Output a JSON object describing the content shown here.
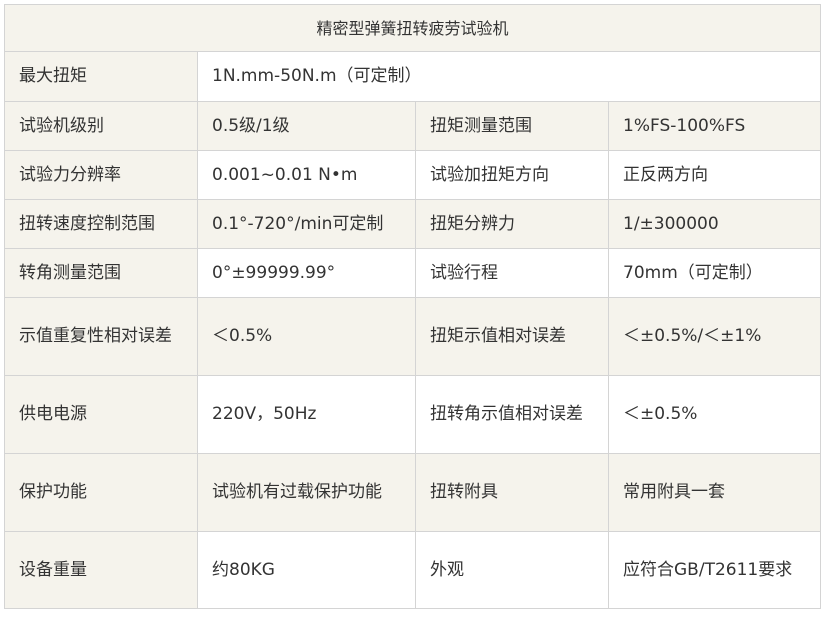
{
  "table": {
    "title": "精密型弹簧扭转疲劳试验机",
    "rows": [
      {
        "l1": "最大扭矩",
        "v1": "1N.mm-50N.m（可定制）"
      },
      {
        "l1": "试验机级别",
        "v1": "0.5级/1级",
        "l2": "扭矩测量范围",
        "v2": "1%FS-100%FS"
      },
      {
        "l1": "试验力分辨率",
        "v1": "0.001~0.01 N•m",
        "l2": "试验加扭矩方向",
        "v2": "正反两方向"
      },
      {
        "l1": "扭转速度控制范围",
        "v1": "0.1°-720°/min可定制",
        "l2": "扭矩分辨力",
        "v2": "1/±300000"
      },
      {
        "l1": "转角测量范围",
        "v1": "0°±99999.99°",
        "l2": "试验行程",
        "v2": "70mm（可定制）"
      },
      {
        "l1": "示值重复性相对误差",
        "v1": "＜0.5%",
        "l2": "扭矩示值相对误差",
        "v2": "＜±0.5%/＜±1%"
      },
      {
        "l1": "供电电源",
        "v1": "220V，50Hz",
        "l2": "扭转角示值相对误差",
        "v2": "＜±0.5%"
      },
      {
        "l1": "保护功能",
        "v1": "试验机有过载保护功能",
        "l2": "扭转附具",
        "v2": "常用附具一套"
      },
      {
        "l1": "设备重量",
        "v1": "约80KG",
        "l2": "外观",
        "v2": "应符合GB/T2611要求"
      }
    ]
  }
}
